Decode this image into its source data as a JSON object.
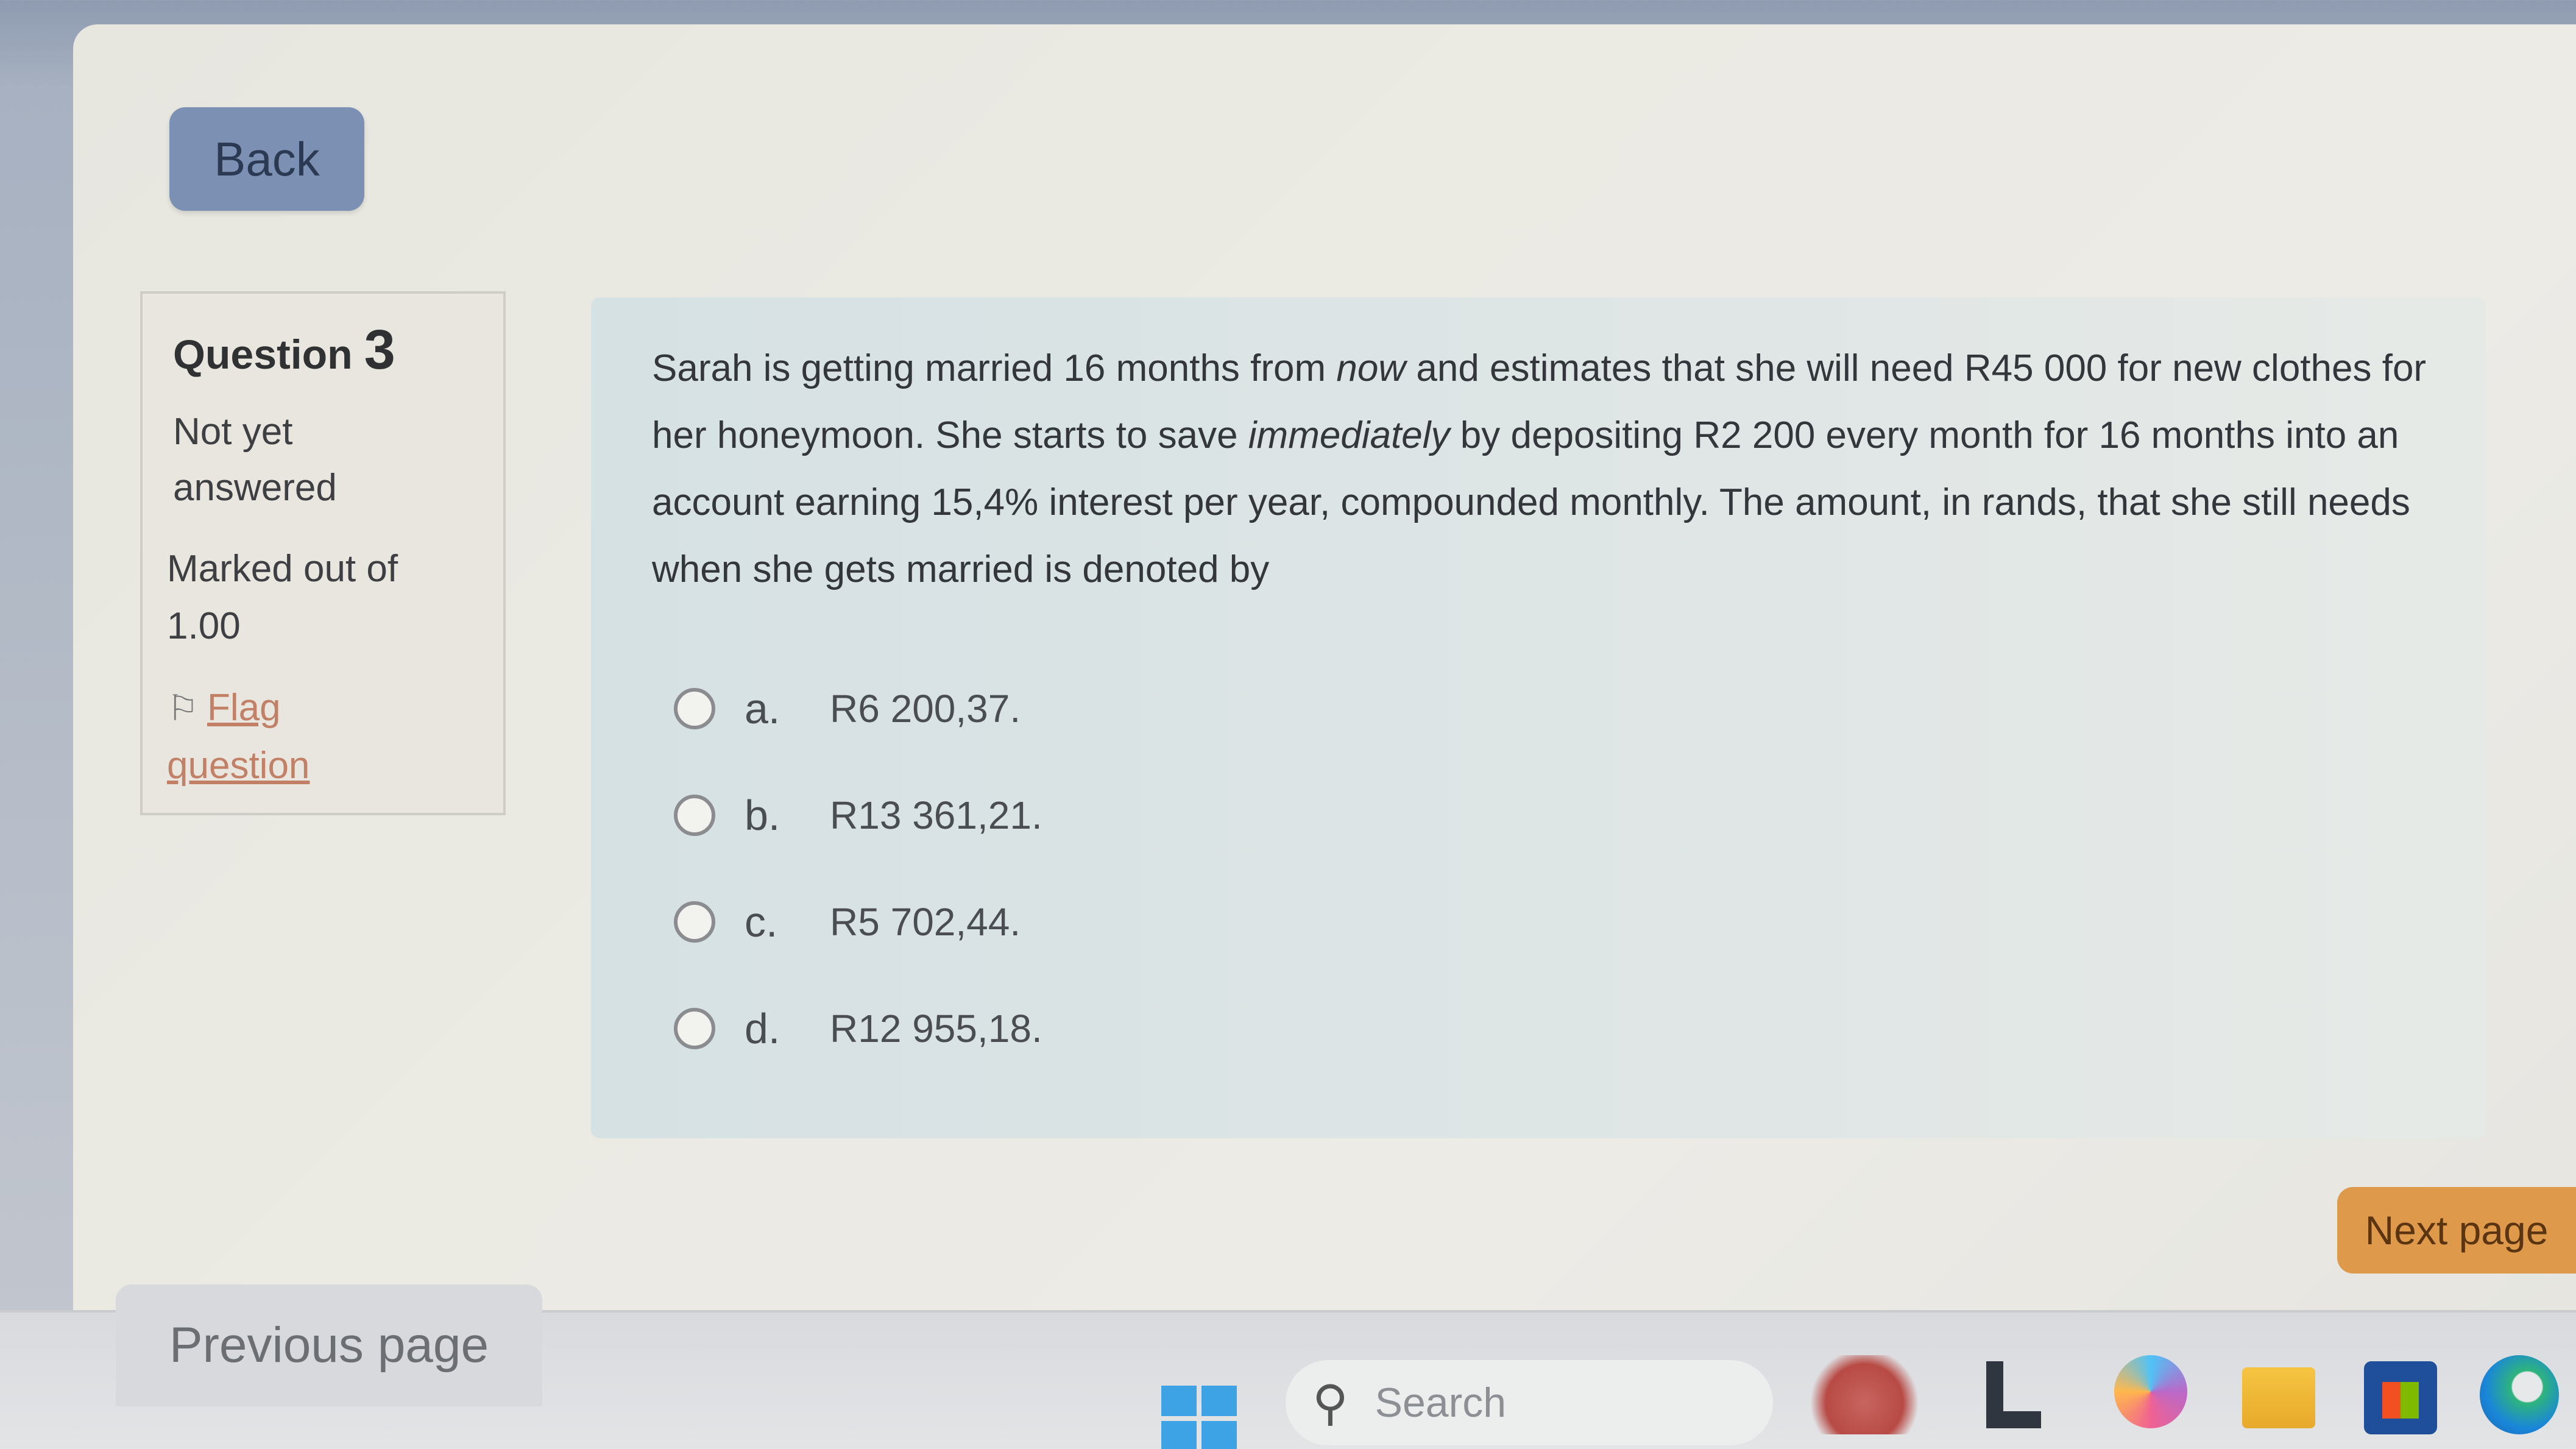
{
  "nav": {
    "back_label": "Back",
    "next_label": "Next page",
    "prev_label": "Previous page"
  },
  "info": {
    "question_word": "Question",
    "question_number": "3",
    "status_line1": "Not yet",
    "status_line2": "answered",
    "marked_line1": "Marked out of",
    "marked_line2": "1.00",
    "flag_line1": "Flag",
    "flag_line2": "question"
  },
  "question": {
    "p1": "Sarah is getting married 16 months from ",
    "em1": "now",
    "p2": " and estimates that she will need R45 000 for new clothes for her honeymoon. She starts to save ",
    "em2": "immediately",
    "p3": " by depositing R2 200 every month for 16 months into an account earning 15,4% interest per year, compounded monthly. The amount, in rands, that she still needs when she gets married is denoted by"
  },
  "options": [
    {
      "letter": "a.",
      "text": "R6 200,37."
    },
    {
      "letter": "b.",
      "text": "R13 361,21."
    },
    {
      "letter": "c.",
      "text": "R5 702,44."
    },
    {
      "letter": "d.",
      "text": "R12 955,18."
    }
  ],
  "taskbar": {
    "search_placeholder": "Search"
  },
  "icons": {
    "flag": "flag-icon",
    "search": "search-icon",
    "start": "windows-start-icon"
  }
}
